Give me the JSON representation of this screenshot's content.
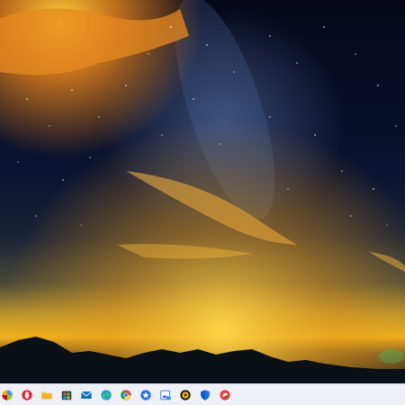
{
  "desktop": {
    "wallpaper": "milky-way-night-sky-over-mountains"
  },
  "taskbar": {
    "background": "#eef0f6",
    "items": [
      {
        "icon": "colorful-app-icon"
      },
      {
        "icon": "opera-browser-icon"
      },
      {
        "icon": "file-explorer-icon"
      },
      {
        "icon": "windows-store-icon"
      },
      {
        "icon": "mail-icon"
      },
      {
        "icon": "edge-browser-icon"
      },
      {
        "icon": "chrome-browser-icon"
      },
      {
        "icon": "blue-star-app-icon"
      },
      {
        "icon": "image-viewer-icon"
      },
      {
        "icon": "media-player-icon"
      },
      {
        "icon": "shield-security-icon"
      },
      {
        "icon": "red-app-icon"
      }
    ]
  }
}
